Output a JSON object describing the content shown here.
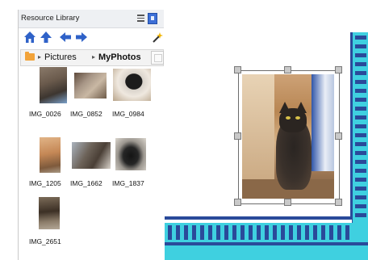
{
  "panel": {
    "title": "Resource Library",
    "toolbar_icons": [
      "home-icon",
      "up-arrow-icon",
      "back-arrow-icon",
      "forward-arrow-icon",
      "magic-wand-icon"
    ],
    "breadcrumb": [
      "Pictures",
      "MyPhotos"
    ]
  },
  "thumbnails": [
    {
      "label": "IMG_0026"
    },
    {
      "label": "IMG_0852"
    },
    {
      "label": "IMG_0984"
    },
    {
      "label": "IMG_1205"
    },
    {
      "label": "IMG_1662"
    },
    {
      "label": "IMG_1837"
    },
    {
      "label": "IMG_2651"
    }
  ],
  "colors": {
    "accent_blue": "#3d6fd6",
    "border_cyan": "#3fd0e0",
    "border_navy": "#2a4a9a",
    "folder": "#f2a33a"
  }
}
